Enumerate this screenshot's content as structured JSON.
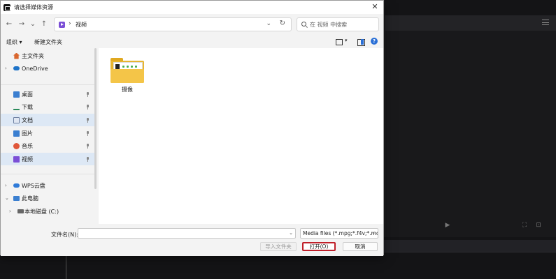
{
  "dialog": {
    "title": "请选择媒体资源",
    "close_glyph": "✕"
  },
  "nav": {
    "back": "←",
    "forward": "→",
    "recent": "⌄",
    "up": "↑",
    "path_sep": "›",
    "current_folder": "视频",
    "dropdown_glyph": "⌄",
    "refresh_glyph": "↻",
    "search_placeholder": "在 视频 中搜索"
  },
  "commands": {
    "organize": "组织 ▾",
    "new_folder": "新建文件夹",
    "view_dropdown": "▾"
  },
  "sidebar": {
    "items": [
      {
        "label": "主文件夹",
        "icon": "home-icon",
        "color": "#d9662f"
      },
      {
        "label": "OneDrive",
        "icon": "cloud-icon",
        "color": "#1e73c8"
      },
      {
        "label": "桌面",
        "icon": "desktop-icon",
        "color": "#3b7fd0"
      },
      {
        "label": "下载",
        "icon": "download-icon",
        "color": "#2a8a5a"
      },
      {
        "label": "文档",
        "icon": "document-icon",
        "color": "#6d7fa0"
      },
      {
        "label": "图片",
        "icon": "pictures-icon",
        "color": "#3b7fd0"
      },
      {
        "label": "音乐",
        "icon": "music-icon",
        "color": "#e0573a"
      },
      {
        "label": "视频",
        "icon": "video-icon",
        "color": "#7b4fd6"
      },
      {
        "label": "WPS云盘",
        "icon": "wps-cloud-icon",
        "color": "#2f7bd8"
      },
      {
        "label": "此电脑",
        "icon": "computer-icon",
        "color": "#3b7fd0"
      },
      {
        "label": "本地磁盘 (C:)",
        "icon": "drive-icon",
        "color": "#555555"
      }
    ]
  },
  "content": {
    "files": [
      {
        "name": "摄像",
        "type": "folder"
      }
    ]
  },
  "footer": {
    "filename_label": "文件名(N):",
    "filename_value": "",
    "filter_value": "Media files (*.mpg;*.f4v;*.mo",
    "import_folder": "导入文件夹",
    "open": "打开(O)",
    "cancel": "取消"
  },
  "background_app": {
    "player_controls": [
      "▶",
      "⛶",
      "⊡"
    ]
  }
}
